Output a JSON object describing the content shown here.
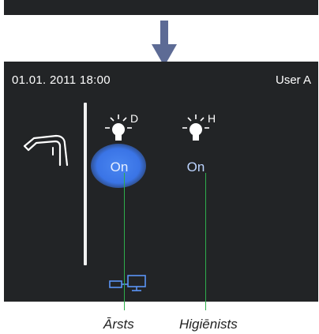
{
  "header": {
    "datetime": "01.01. 2011 18:00",
    "user": "User A"
  },
  "lights": [
    {
      "letter": "D",
      "state": "On",
      "highlighted": true,
      "caption": "Ārsts"
    },
    {
      "letter": "H",
      "state": "On",
      "highlighted": false,
      "caption": "Higiēnists"
    }
  ],
  "icons": {
    "flow": "arrow-down-icon",
    "instrument": "handpiece-icon",
    "light": "lamp-icon",
    "connection": "network-icon"
  },
  "colors": {
    "screen_bg": "#222426",
    "highlight": "#3a74e6",
    "accent_blue": "#5b94f5",
    "callout": "#2eae4c"
  }
}
